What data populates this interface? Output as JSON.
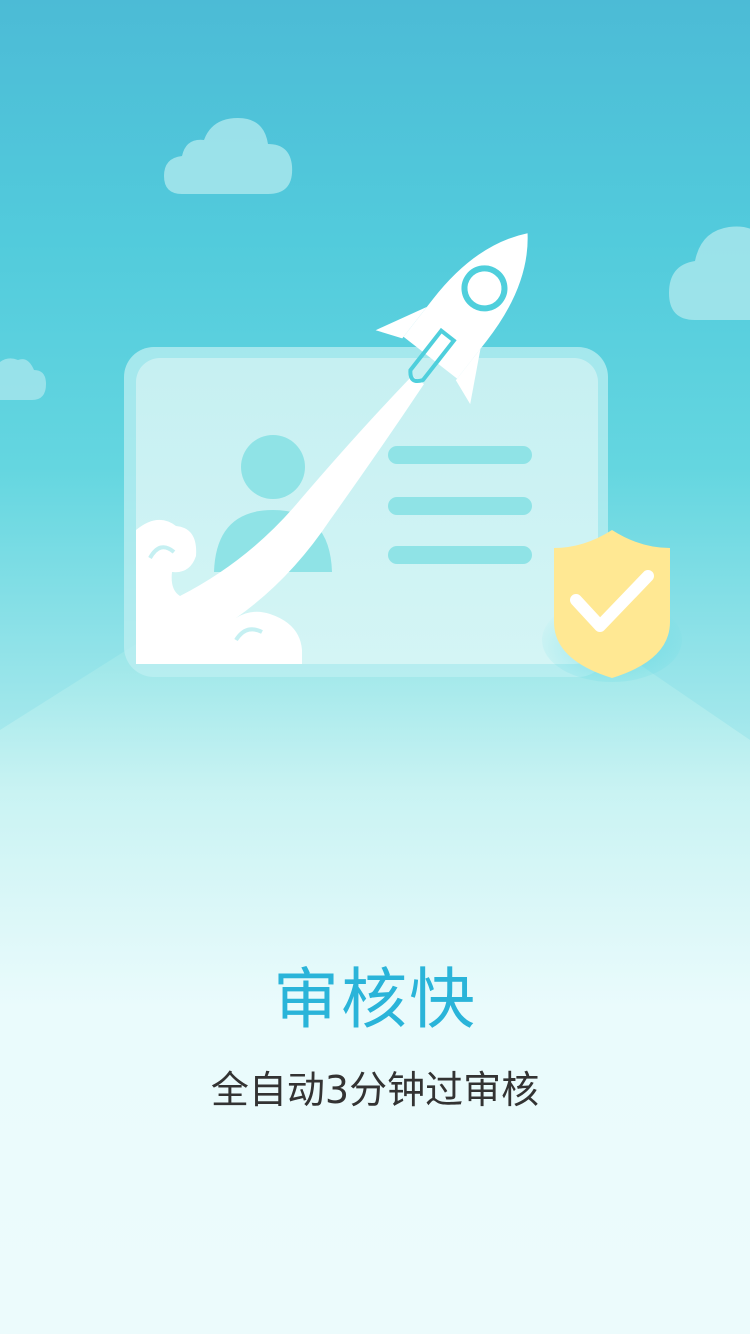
{
  "onboarding": {
    "title": "审核快",
    "subtitle": "全自动3分钟过审核"
  },
  "colors": {
    "title": "#2ab4d9",
    "subtitle": "#333333",
    "sky_top": "#4cbbd6",
    "shield": "#ffe893"
  },
  "icons": {
    "rocket": "rocket-icon",
    "shield": "shield-check-icon",
    "id_card": "id-card-illustration",
    "avatar": "person-avatar-icon"
  }
}
